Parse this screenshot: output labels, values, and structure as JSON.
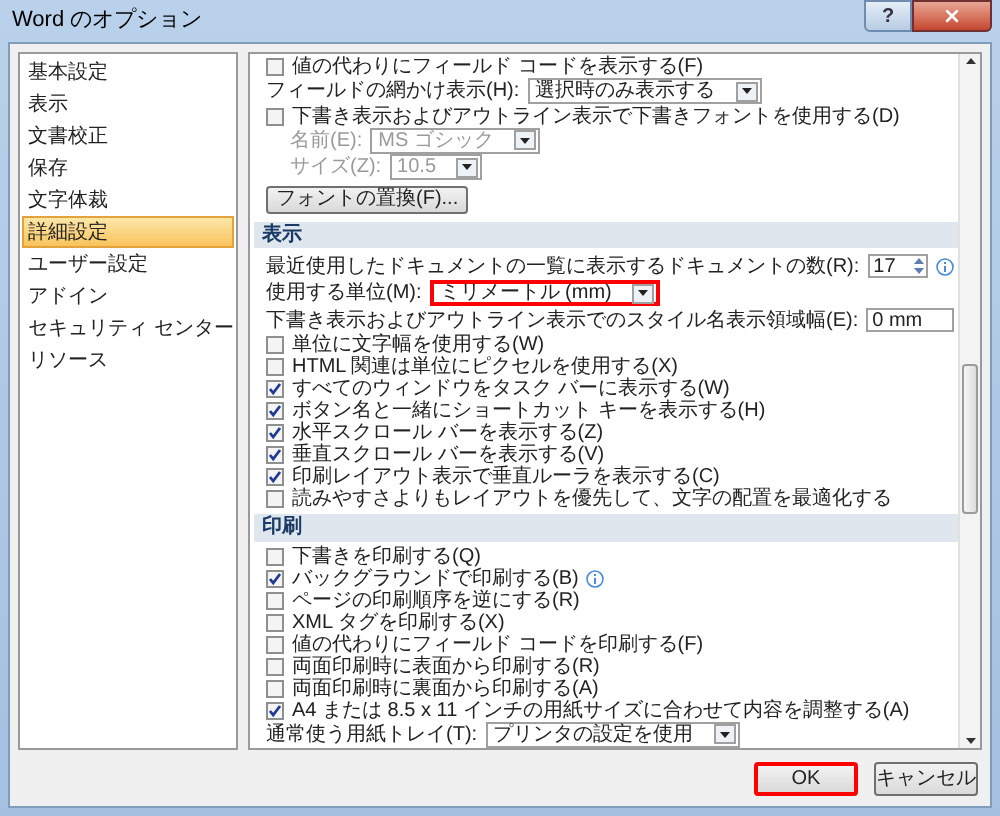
{
  "window": {
    "title": "Word のオプション",
    "help_button": "?"
  },
  "sidebar": {
    "items": [
      {
        "label": "基本設定",
        "selected": false
      },
      {
        "label": "表示",
        "selected": false
      },
      {
        "label": "文書校正",
        "selected": false
      },
      {
        "label": "保存",
        "selected": false
      },
      {
        "label": "文字体裁",
        "selected": false
      },
      {
        "label": "詳細設定",
        "selected": true
      },
      {
        "label": "ユーザー設定",
        "selected": false
      },
      {
        "label": "アドイン",
        "selected": false
      },
      {
        "label": "セキュリティ センター",
        "selected": false
      },
      {
        "label": "リソース",
        "selected": false
      }
    ]
  },
  "content": {
    "rows": [
      {
        "kind": "checkbox",
        "label": "値の代わりにフィールド コードを表示する(F)",
        "checked": false
      },
      {
        "kind": "select",
        "label": "フィールドの網かけ表示(H):",
        "value": "選択時のみ表示する",
        "disabled": false,
        "highlighted": false
      },
      {
        "kind": "checkbox",
        "label": "下書き表示およびアウトライン表示で下書きフォントを使用する(D)",
        "checked": false,
        "children": [
          {
            "kind": "select",
            "label": "名前(E):",
            "value": "MS ゴシック",
            "disabled": true,
            "highlighted": false
          },
          {
            "kind": "select",
            "label": "サイズ(Z):",
            "value": "10.5",
            "disabled": true,
            "highlighted": false
          }
        ]
      },
      {
        "kind": "button",
        "label": "フォントの置換(F)..."
      },
      {
        "kind": "section",
        "label": "表示"
      },
      {
        "kind": "spinner",
        "label": "最近使用したドキュメントの一覧に表示するドキュメントの数(R):",
        "value": "17",
        "info": true
      },
      {
        "kind": "select",
        "label": "使用する単位(M):",
        "value": "ミリメートル (mm)",
        "disabled": false,
        "highlighted": true
      },
      {
        "kind": "field",
        "label": "下書き表示およびアウトライン表示でのスタイル名表示領域幅(E):",
        "value": "0 mm"
      },
      {
        "kind": "checkbox",
        "label": "単位に文字幅を使用する(W)",
        "checked": false
      },
      {
        "kind": "checkbox",
        "label": "HTML 関連は単位にピクセルを使用する(X)",
        "checked": false
      },
      {
        "kind": "checkbox",
        "label": "すべてのウィンドウをタスク バーに表示する(W)",
        "checked": true
      },
      {
        "kind": "checkbox",
        "label": "ボタン名と一緒にショートカット キーを表示する(H)",
        "checked": true
      },
      {
        "kind": "checkbox",
        "label": "水平スクロール バーを表示する(Z)",
        "checked": true
      },
      {
        "kind": "checkbox",
        "label": "垂直スクロール バーを表示する(V)",
        "checked": true
      },
      {
        "kind": "checkbox",
        "label": "印刷レイアウト表示で垂直ルーラを表示する(C)",
        "checked": true
      },
      {
        "kind": "checkbox",
        "label": "読みやすさよりもレイアウトを優先して、文字の配置を最適化する",
        "checked": false
      },
      {
        "kind": "section",
        "label": "印刷"
      },
      {
        "kind": "checkbox",
        "label": "下書きを印刷する(Q)",
        "checked": false
      },
      {
        "kind": "checkbox",
        "label": "バックグラウンドで印刷する(B)",
        "checked": true,
        "info": true
      },
      {
        "kind": "checkbox",
        "label": "ページの印刷順序を逆にする(R)",
        "checked": false
      },
      {
        "kind": "checkbox",
        "label": "XML タグを印刷する(X)",
        "checked": false
      },
      {
        "kind": "checkbox",
        "label": "値の代わりにフィールド コードを印刷する(F)",
        "checked": false
      },
      {
        "kind": "checkbox",
        "label": "両面印刷時に表面から印刷する(R)",
        "checked": false
      },
      {
        "kind": "checkbox",
        "label": "両面印刷時に裏面から印刷する(A)",
        "checked": false
      },
      {
        "kind": "checkbox",
        "label": "A4 または 8.5 x 11 インチの用紙サイズに合わせて内容を調整する(A)",
        "checked": true
      },
      {
        "kind": "select",
        "label": "通常使う用紙トレイ(T):",
        "value": "プリンタの設定を使用",
        "disabled": false,
        "highlighted": false
      }
    ]
  },
  "buttons": [
    {
      "label": "OK",
      "highlighted": true
    },
    {
      "label": "キャンセル",
      "highlighted": false
    }
  ]
}
